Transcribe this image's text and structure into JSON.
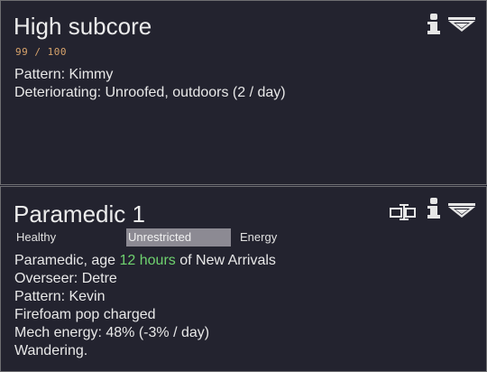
{
  "colors": {
    "background": "#23232f",
    "border": "#6e6e72",
    "text": "#e8e8e8",
    "durability": "#d8a36b",
    "accent_green": "#6fd26f",
    "restriction_bg": "#8c8a93"
  },
  "top_panel": {
    "title": "High subcore",
    "durability": "99 / 100",
    "lines": [
      "Pattern: Kimmy",
      "Deteriorating: Unroofed, outdoors (2 / day)"
    ],
    "icons": [
      "info-icon",
      "dropdown-icon"
    ]
  },
  "bottom_panel": {
    "title": "Paramedic 1",
    "tags": {
      "health": "Healthy",
      "restriction": "Unrestricted",
      "energy": "Energy"
    },
    "line1": {
      "prefix": "Paramedic, age ",
      "age": "12 hours",
      "suffix": " of New Arrivals"
    },
    "lines": [
      "Overseer: Detre",
      "Pattern: Kevin",
      "Firefoam pop charged",
      "Mech energy: 48% (-3% / day)",
      "Wandering."
    ],
    "icons": [
      "rename-icon",
      "info-icon",
      "dropdown-icon"
    ]
  }
}
